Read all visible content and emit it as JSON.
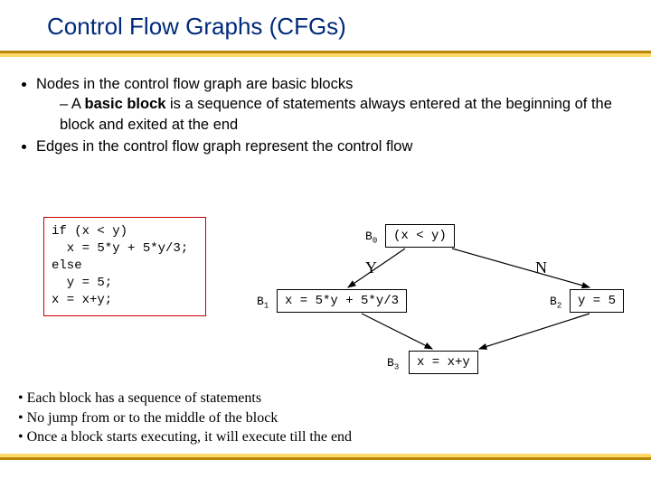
{
  "title": "Control Flow Graphs (CFGs)",
  "bullets": {
    "b1": "Nodes in the control flow graph are basic blocks",
    "b1a_pre": "A ",
    "b1a_bold": "basic block",
    "b1a_post": " is a sequence of statements always entered at the beginning of the block and exited at the end",
    "b2": "Edges in the control flow graph represent the control flow"
  },
  "code": "if (x < y)\n  x = 5*y + 5*y/3;\nelse\n  y = 5;\nx = x+y;",
  "graph": {
    "B0_label": "B",
    "B0_sub": "0",
    "B0_text": "(x < y)",
    "Y": "Y",
    "N": "N",
    "B1_label": "B",
    "B1_sub": "1",
    "B1_text": "x = 5*y + 5*y/3",
    "B2_label": "B",
    "B2_sub": "2",
    "B2_text": "y = 5",
    "B3_label": "B",
    "B3_sub": "3",
    "B3_text": "x = x+y"
  },
  "notes": {
    "n1": "• Each block has a sequence of statements",
    "n2": "• No jump from or to the middle of the block",
    "n3": "• Once a block starts executing, it will execute till the end"
  }
}
